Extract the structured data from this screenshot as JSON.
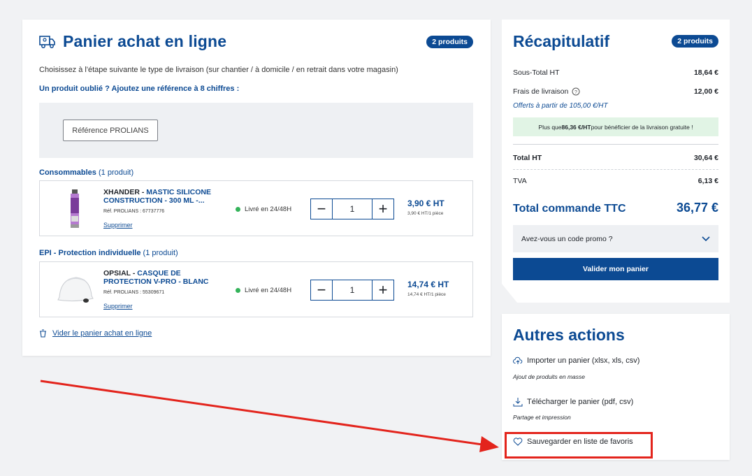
{
  "cart": {
    "title": "Panier achat en ligne",
    "badge": "2 produits",
    "intro": "Choisissez à l'étape suivante le type de livraison (sur chantier / à domicile / en retrait dans votre magasin)",
    "forgot": "Un produit oublié ? Ajoutez une référence à 8 chiffres :",
    "ref_placeholder": "Référence PROLIANS",
    "categories": [
      {
        "name": "Consommables",
        "count": "(1 produit)",
        "product": {
          "brand": "XHANDER",
          "name_sep": " - ",
          "name": "MASTIC SILICONE CONSTRUCTION - 300 ML -...",
          "ref": "Réf. PROLIANS : 67737776",
          "delete": "Supprimer",
          "stock": "Livré en 24/48H",
          "qty": "1",
          "price": "3,90 € HT",
          "unit_price": "3,90 € HT/1 pièce",
          "image": "silicone-tube"
        }
      },
      {
        "name": "EPI - Protection individuelle",
        "count": "(1 produit)",
        "product": {
          "brand": "OPSIAL",
          "name_sep": " - ",
          "name": "CASQUE DE PROTECTION V-PRO - BLANC",
          "ref": "Réf. PROLIANS : 55309671",
          "delete": "Supprimer",
          "stock": "Livré en 24/48H",
          "qty": "1",
          "price": "14,74 € HT",
          "unit_price": "14,74 € HT/1 pièce",
          "image": "safety-helmet"
        }
      }
    ],
    "empty_cart": "Vider le panier achat en ligne"
  },
  "summary": {
    "title": "Récapitulatif",
    "badge": "2 produits",
    "subtotal_label": "Sous-Total HT",
    "subtotal_value": "18,64 €",
    "shipping_label": "Frais de livraison",
    "shipping_value": "12,00 €",
    "free_shipping": "Offerts à partir de 105,00 €/HT",
    "banner_pre": "Plus que ",
    "banner_amount": "86,36 €/HT",
    "banner_post": " pour bénéficier de la livraison gratuite !",
    "total_ht_label": "Total HT",
    "total_ht_value": "30,64 €",
    "tva_label": "TVA",
    "tva_value": "6,13 €",
    "total_ttc_label": "Total commande TTC",
    "total_ttc_value": "36,77 €",
    "promo_label": "Avez-vous un code promo ?",
    "validate_label": "Valider mon panier"
  },
  "actions": {
    "title": "Autres actions",
    "items": [
      {
        "label": "Importer un panier (xlsx, xls, csv)",
        "sub": "Ajout de produits en masse",
        "icon": "cloud-upload-icon"
      },
      {
        "label": "Télécharger le panier (pdf, csv)",
        "sub": "Partage et impression",
        "icon": "download-icon"
      },
      {
        "label": "Sauvegarder en liste de favoris",
        "sub": "",
        "icon": "heart-icon"
      }
    ]
  },
  "colors": {
    "brand": "#0c4a93",
    "stock": "#34b35a",
    "highlight": "#e3241c",
    "banner": "#e1f4e5"
  }
}
